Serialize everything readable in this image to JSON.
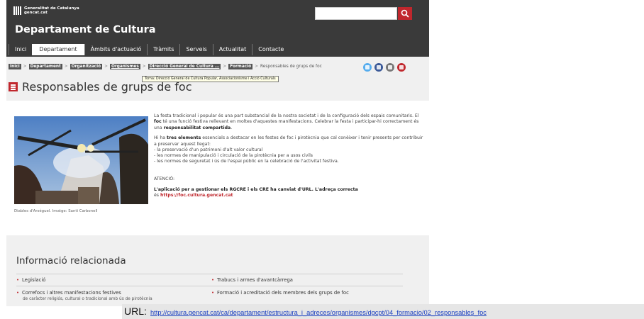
{
  "header": {
    "logo_line1": "Generalitat de Catalunya",
    "logo_line2": "gencat.cat",
    "department": "Departament de Cultura",
    "search_placeholder": ""
  },
  "nav": [
    {
      "label": "Inici"
    },
    {
      "label": "Departament",
      "active": true
    },
    {
      "label": "Àmbits d'actuació"
    },
    {
      "label": "Tràmits"
    },
    {
      "label": "Serveis"
    },
    {
      "label": "Actualitat"
    },
    {
      "label": "Contacte"
    }
  ],
  "breadcrumb": {
    "items": [
      "Inici",
      "Departament",
      "Organització",
      "Organismes",
      "Direcció General de Cultura ...",
      "Formació"
    ],
    "current": "Responsables de grups de foc",
    "tooltip": "Torna: Direcció General de Cultura Popular, Associacionisme i Acció Culturals"
  },
  "share_icons": [
    {
      "name": "twitter-icon",
      "color": "#55acee"
    },
    {
      "name": "facebook-icon",
      "color": "#3b5998"
    },
    {
      "name": "email-icon",
      "color": "#777777"
    },
    {
      "name": "print-icon",
      "color": "#c0272d"
    }
  ],
  "page": {
    "title": "Responsables de grups de foc",
    "image_caption": "Diables d'Arséguel. Imatge: Santi Carbonell",
    "intro_1": "La festa tradicional i popular és una part substancial de la nostra societat i de la configuració dels espais comunitaris. El ",
    "intro_foc": "foc",
    "intro_2": " té una funció festiva rellevant en moltes d'aquestes manifestacions. Celebrar la festa i participar-hi correctament és una ",
    "intro_resp": "responsabilitat compartida",
    "intro_3": ".",
    "elements_1": "Hi ha ",
    "elements_bold": "tres elements",
    "elements_2": " essencials a destacar en les festes de foc i pirotècnia que cal conèixer i tenir presents per contribuir a preservar aquest llegat:",
    "list": [
      "- la preservació d'un patrimoni d'alt valor cultural",
      "- les normes de manipulació i circulació de la pirotècnia per a usos civils",
      "- les normes de seguretat i ús de l'espai públic en la celebració de l'activitat festiva."
    ],
    "atencio": "ATENCIÓ:",
    "notice_bold": "L'aplicació per a gestionar els RGCRE i els CRE ha canviat d'URL. L'adreça correcta",
    "notice_es": "és ",
    "notice_link": "https://foc.cultura.gencat.cat"
  },
  "related": {
    "title": "Informació relacionada",
    "items": [
      {
        "label": "Legislació"
      },
      {
        "label": "Trabucs i armes d'avantcàrrega"
      },
      {
        "label": "Correfocs i altres manifestacions festives"
      },
      {
        "label": "Formació i acreditació dels membres dels grups de foc"
      }
    ],
    "sub": "de caràcter religiós, cultural o tradicional amb ús de pirotècnia"
  },
  "url_bar": {
    "label": "URL:",
    "url": "http://cultura.gencat.cat/ca/departament/estructura_i_adreces/organismes/dgcpt/04_formacio/02_responsables_foc"
  }
}
